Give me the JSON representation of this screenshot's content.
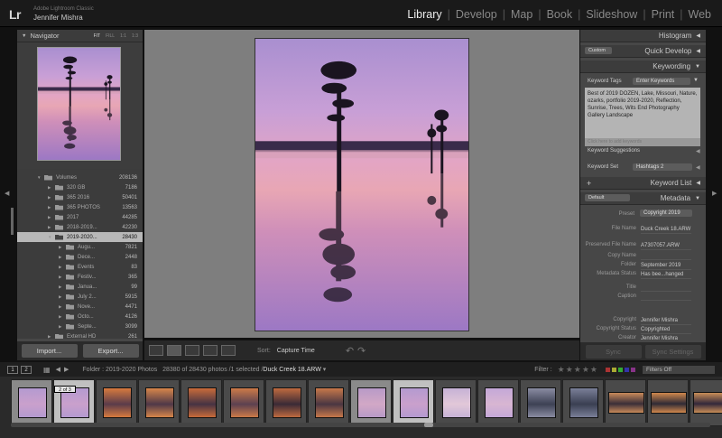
{
  "app": {
    "logo": "Lr",
    "name": "Adobe Lightroom Classic",
    "user": "Jennifer Mishra"
  },
  "modules": [
    {
      "label": "Library",
      "active": true
    },
    {
      "label": "Develop"
    },
    {
      "label": "Map"
    },
    {
      "label": "Book"
    },
    {
      "label": "Slideshow"
    },
    {
      "label": "Print"
    },
    {
      "label": "Web"
    }
  ],
  "navigator": {
    "title": "Navigator",
    "zoom_options": [
      "FIT",
      "FILL",
      "1:1",
      "1:3"
    ]
  },
  "folders": [
    {
      "name": "Volumes",
      "count": "208136",
      "level": 0,
      "expanded": true
    },
    {
      "name": "320 GB",
      "count": "7186",
      "level": 1
    },
    {
      "name": "365 2016",
      "count": "50401",
      "level": 1
    },
    {
      "name": "365 PHOTOS",
      "count": "13563",
      "level": 1
    },
    {
      "name": "2017",
      "count": "44285",
      "level": 1
    },
    {
      "name": "2018-2019...",
      "count": "42230",
      "level": 1
    },
    {
      "name": "2019-2020...",
      "count": "28430",
      "level": 1,
      "selected": true,
      "expanded": true
    },
    {
      "name": "Augu...",
      "count": "7821",
      "level": 2
    },
    {
      "name": "Dece...",
      "count": "2448",
      "level": 2
    },
    {
      "name": "Events",
      "count": "83",
      "level": 2
    },
    {
      "name": "Festiv...",
      "count": "365",
      "level": 2
    },
    {
      "name": "Janua...",
      "count": "99",
      "level": 2
    },
    {
      "name": "July 2...",
      "count": "5915",
      "level": 2
    },
    {
      "name": "Nove...",
      "count": "4471",
      "level": 2
    },
    {
      "name": "Octo...",
      "count": "4126",
      "level": 2
    },
    {
      "name": "Septe...",
      "count": "3099",
      "level": 2
    },
    {
      "name": "External HD",
      "count": "261",
      "level": 1
    }
  ],
  "left_buttons": {
    "import": "Import...",
    "export": "Export..."
  },
  "toolbar": {
    "sort_label": "Sort:",
    "sort_value": "Capture Time"
  },
  "right": {
    "histogram": "Histogram",
    "quick_develop_preset": "Custom",
    "quick_develop": "Quick Develop",
    "keywording": "Keywording",
    "keyword_tags_label": "Keyword Tags",
    "keyword_tags_value": "Enter Keywords",
    "keywords_text": "Best of 2019 DOZEN, Lake, Missouri, Nature, ozarks, portfolio 2019-2020, Reflection, Sunrise, Trees, Wits End Photography Gallery Landscape",
    "keywords_placeholder": "Click here to add keywords",
    "keyword_suggestions": "Keyword Suggestions",
    "keyword_set_label": "Keyword Set",
    "keyword_set_value": "Hashtags 2",
    "keyword_list": "Keyword List",
    "metadata_preset_drop": "Default",
    "metadata": "Metadata",
    "preset_label": "Preset",
    "preset_value": "Copyright 2019",
    "fields": [
      {
        "label": "File Name",
        "value": "Duck Creek 18.ARW"
      },
      {
        "label": "Preserved File Name",
        "value": "A7307057.ARW"
      },
      {
        "label": "Copy Name",
        "value": ""
      },
      {
        "label": "Folder",
        "value": "September 2019"
      },
      {
        "label": "Metadata Status",
        "value": "Has bee...hanged"
      },
      {
        "label": "Title",
        "value": ""
      },
      {
        "label": "Caption",
        "value": ""
      },
      {
        "label": "Copyright",
        "value": "Jennifer Mishra"
      },
      {
        "label": "Copyright Status",
        "value": "Copyrighted"
      },
      {
        "label": "Creator",
        "value": "Jennifer Mishra"
      }
    ],
    "sync": "Sync",
    "sync_settings": "Sync Settings"
  },
  "filmstrip_bar": {
    "screen1": "1",
    "screen2": "2",
    "folder": "Folder : 2019-2020 Photos",
    "counts": "28380 of 28430 photos /1 selected /",
    "filename": "Duck Creek 18.ARW",
    "filter": "Filter :",
    "filters_off": "Filters Off"
  },
  "filmstrip": {
    "badge": "2 of 3"
  },
  "colors": {
    "accent": "#ededed",
    "panel": "#474747",
    "background": "#7e7e7e"
  }
}
